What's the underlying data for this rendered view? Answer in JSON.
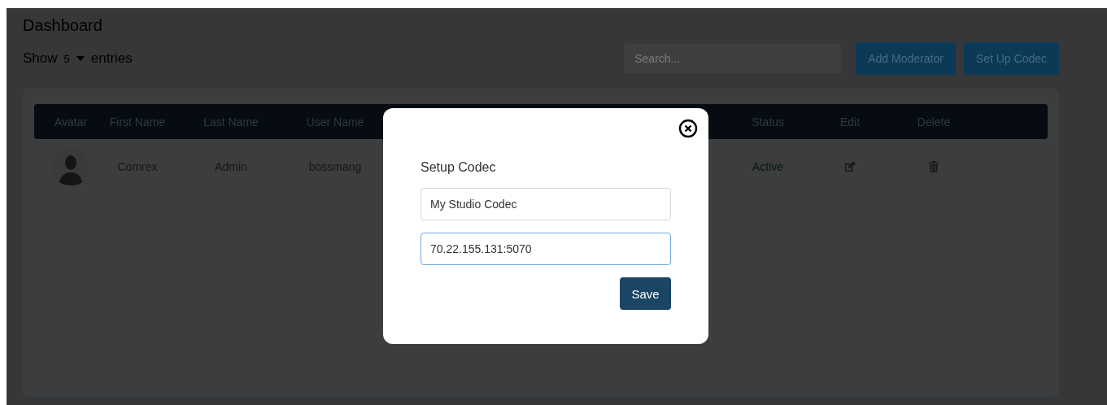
{
  "page": {
    "title": "Dashboard"
  },
  "entries": {
    "before": "Show",
    "value": "5",
    "after": "entries"
  },
  "search": {
    "placeholder": "Search..."
  },
  "actions": [
    "Add Moderator",
    "Set Up Codec"
  ],
  "table": {
    "columns": [
      "Avatar",
      "First Name",
      "Last Name",
      "User Name",
      "",
      "Status",
      "Edit",
      "Delete"
    ],
    "rows": [
      {
        "first_name": "Comrex",
        "last_name": "Admin",
        "user_name": "bossmang",
        "status": "Active"
      }
    ]
  },
  "modal": {
    "title": "Setup Codec",
    "fields": [
      {
        "value": "My Studio Codec",
        "focused": false
      },
      {
        "value": "70.22.155.131:5070",
        "focused": true
      }
    ],
    "button": "Save"
  }
}
